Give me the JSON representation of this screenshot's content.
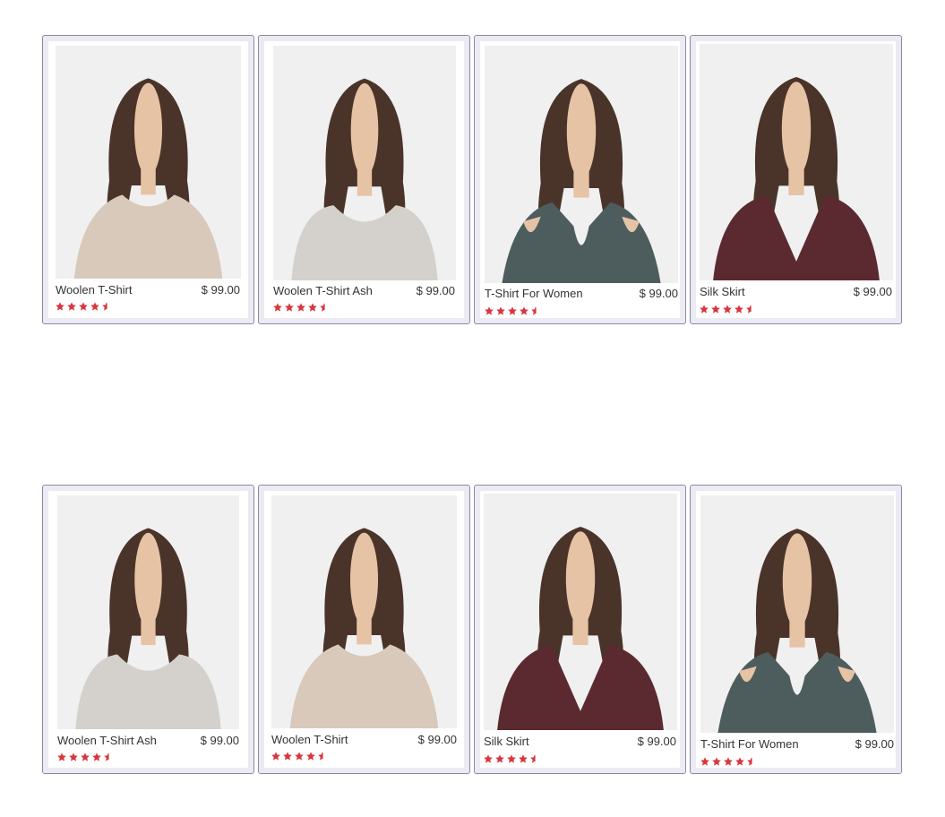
{
  "colors": {
    "star": "#d9363e",
    "photo_bg": "#f0f0f0",
    "hair": "#4a3429",
    "skin": "#e7c3a6",
    "tops": {
      "beige": "#d8c9bb",
      "ash": "#d4d0cb",
      "teal": "#4d5d5e",
      "wine": "#5b2a31"
    }
  },
  "products": [
    {
      "name": "Woolen T-Shirt",
      "price": "$ 99.00",
      "rating": 4.5,
      "top": "beige",
      "style": "round"
    },
    {
      "name": "Woolen T-Shirt Ash",
      "price": "$ 99.00",
      "rating": 4.5,
      "top": "ash",
      "style": "wide"
    },
    {
      "name": "T-Shirt For Women",
      "price": "$ 99.00",
      "rating": 4.5,
      "top": "teal",
      "style": "cold"
    },
    {
      "name": "Silk Skirt",
      "price": "$ 99.00",
      "rating": 4.5,
      "top": "wine",
      "style": "vneck"
    },
    {
      "name": "Woolen T-Shirt Ash",
      "price": "$ 99.00",
      "rating": 4.5,
      "top": "ash",
      "style": "wide"
    },
    {
      "name": "Woolen T-Shirt",
      "price": "$ 99.00",
      "rating": 4.5,
      "top": "beige",
      "style": "round"
    },
    {
      "name": "Silk Skirt",
      "price": "$ 99.00",
      "rating": 4.5,
      "top": "wine",
      "style": "vneck"
    },
    {
      "name": "T-Shirt For Women",
      "price": "$ 99.00",
      "rating": 4.5,
      "top": "teal",
      "style": "cold"
    }
  ]
}
